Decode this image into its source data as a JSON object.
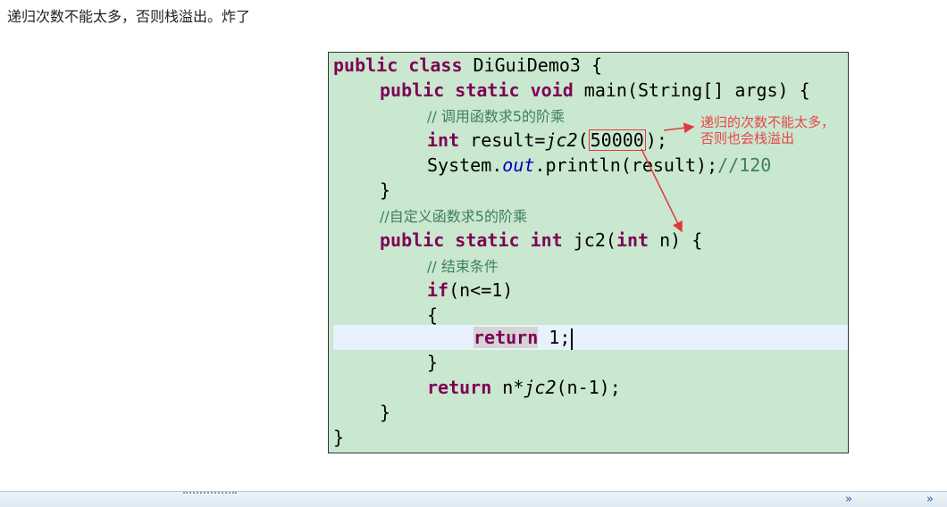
{
  "note": {
    "text": "递归次数不能太多，否则栈溢出。炸了"
  },
  "code": {
    "line1": {
      "kw1": "public",
      "kw2": "class",
      "rest": " DiGuiDemo3 {"
    },
    "line2": {
      "kw1": "public",
      "kw2": "static",
      "kw3": "void",
      "rest": " main(String[] args) {"
    },
    "line3": {
      "comment": "// 调用函数求5的阶乘"
    },
    "line4": {
      "kw": "int",
      "pre": " result=",
      "method": "jc2",
      "open": "(",
      "num": "50000",
      "close": ");"
    },
    "line5": {
      "pre": "System.",
      "field": "out",
      "mid": ".println(result);",
      "comment": "//120"
    },
    "line6": {
      "text": "}"
    },
    "line7": {
      "comment": "//自定义函数求5的阶乘"
    },
    "line8": {
      "kw1": "public",
      "kw2": "static",
      "kw3": "int",
      "mid": " jc2(",
      "kw4": "int",
      "rest": " n) {"
    },
    "line9": {
      "comment": "// 结束条件"
    },
    "line10": {
      "kw": "if",
      "rest": "(n<=1)"
    },
    "line11": {
      "text": "{"
    },
    "line12": {
      "kw": "return",
      "rest": " 1;"
    },
    "line13": {
      "text": "}"
    },
    "line14": {
      "kw": "return",
      "pre": " n*",
      "method": "jc2",
      "rest": "(n-1);"
    },
    "line15": {
      "text": "}"
    },
    "line16": {
      "text": "}"
    }
  },
  "annotation": {
    "text": "递归的次数不能太多，否则也会栈溢出"
  },
  "bottom_bar": {
    "chevron1": "»",
    "chevron2": "»"
  },
  "colors": {
    "code_bg": "#c9e8cf",
    "keyword": "#7f0055",
    "comment": "#3f7f5f",
    "annotation": "#e8444a",
    "field": "#0000c0"
  }
}
